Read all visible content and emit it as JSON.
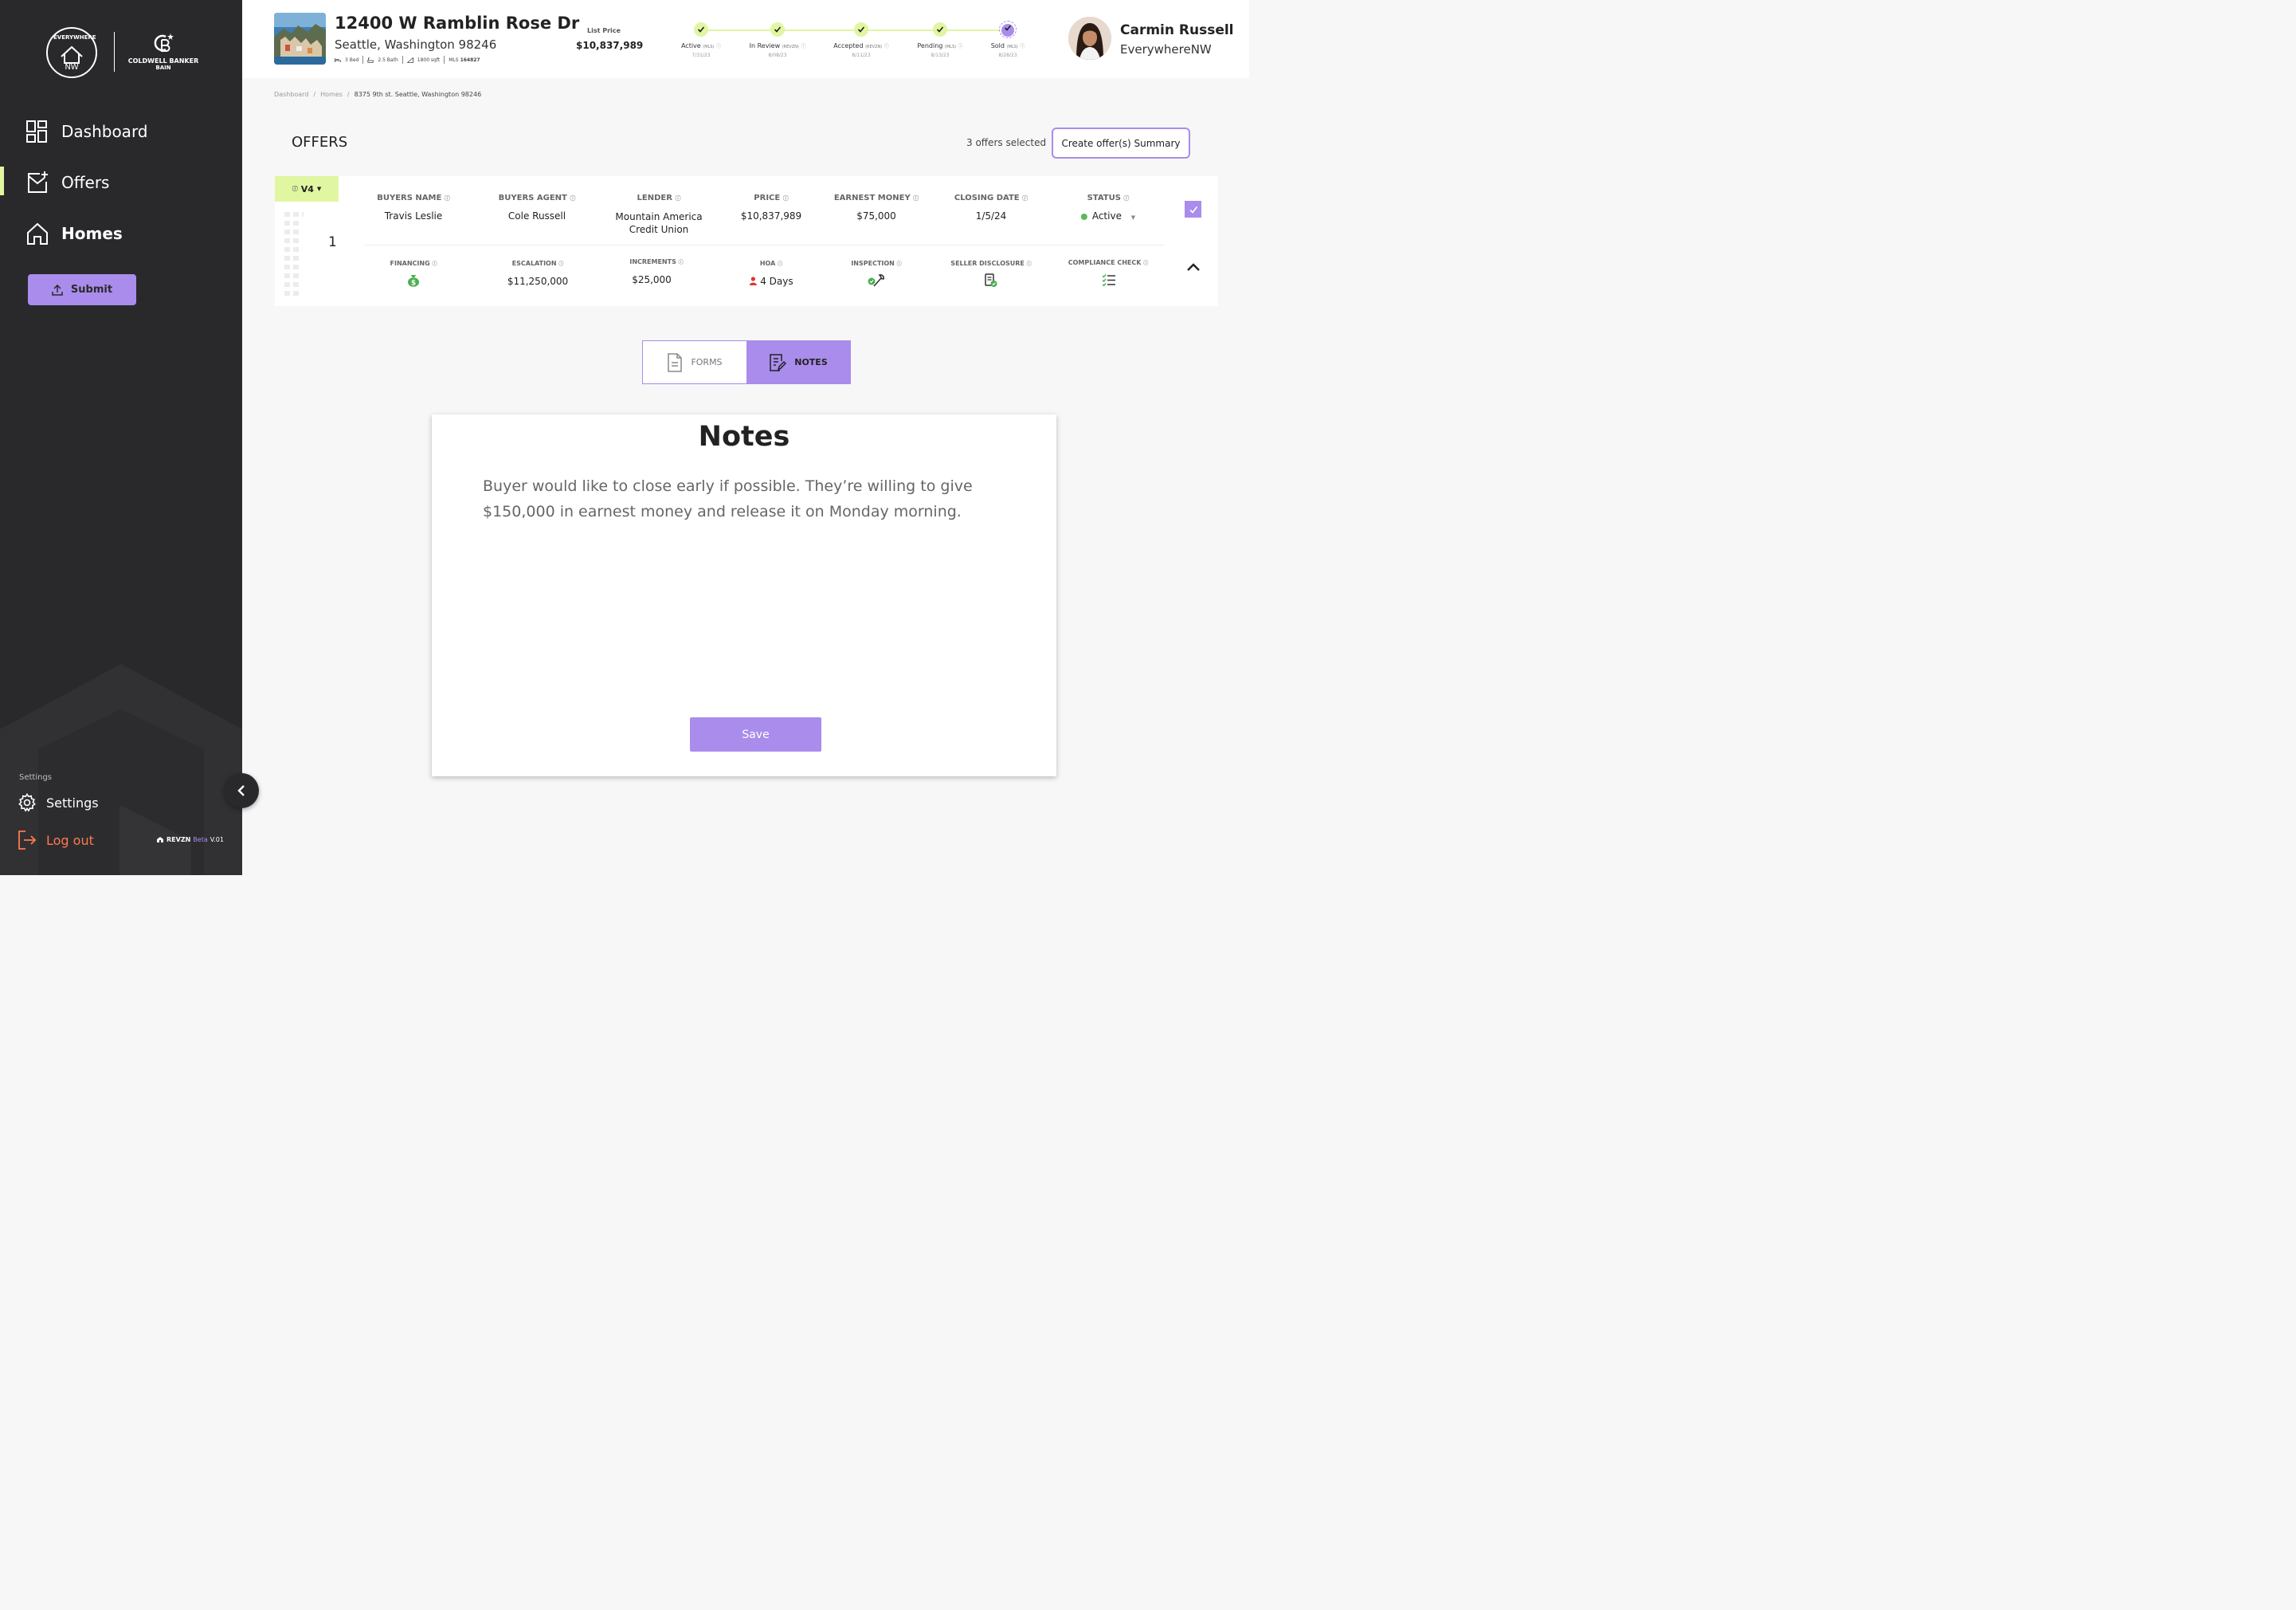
{
  "sidebar": {
    "logo_text": "EVERYWHERE",
    "logo_sub": "NW",
    "brand_name": "COLDWELL BANKER",
    "brand_sub": "BAIN",
    "nav": [
      {
        "label": "Dashboard",
        "icon": "dashboard-icon",
        "active": false
      },
      {
        "label": "Offers",
        "icon": "offers-icon",
        "active": true
      },
      {
        "label": "Homes",
        "icon": "home-icon",
        "active": false
      }
    ],
    "submit_label": "Submit",
    "settings_section_label": "Settings",
    "settings_label": "Settings",
    "logout_label": "Log out",
    "footer_brand": "REVZN",
    "footer_beta": "Beta",
    "footer_version": "V.01"
  },
  "header": {
    "address": "12400 W Ramblin Rose Dr",
    "city_line": "Seattle, Washington 98246",
    "beds": "3 Bed",
    "baths": "2.5 Bath",
    "sqft": "1800 sqft",
    "mls_label": "MLS",
    "mls_number": "164827",
    "list_price_label": "List Price",
    "list_price": "$10,837,989",
    "steps": [
      {
        "name": "Active",
        "tag": "(MLS)",
        "date": "7/31/23"
      },
      {
        "name": "In Review",
        "tag": "(REVZN)",
        "date": "8/08/23"
      },
      {
        "name": "Accepted",
        "tag": "(REVZN)",
        "date": "8/11/23"
      },
      {
        "name": "Pending",
        "tag": "(MLS)",
        "date": "8/13/23"
      },
      {
        "name": "Sold",
        "tag": "(MLS)",
        "date": "8/28/23"
      }
    ],
    "user_name": "Carmin Russell",
    "user_org": "EverywhereNW"
  },
  "breadcrumb": [
    "Dashboard",
    "Homes",
    "8375 9th st. Seattle, Washington 98246"
  ],
  "offers": {
    "title": "OFFERS",
    "selected_count": "3 offers selected",
    "summary_button": "Create offer(s) Summary"
  },
  "offer": {
    "version": "V4",
    "number": "1",
    "columns": [
      "BUYERS NAME",
      "BUYERS AGENT",
      "LENDER",
      "PRICE",
      "EARNEST MONEY",
      "CLOSING DATE",
      "STATUS"
    ],
    "buyers_name": "Travis Leslie",
    "buyers_agent": "Cole Russell",
    "lender_line1": "Mountain America",
    "lender_line2": "Credit Union",
    "price": "$10,837,989",
    "earnest_money": "$75,000",
    "closing_date": "1/5/24",
    "status": "Active",
    "details": [
      "FINANCING",
      "ESCALATION",
      "INCREMENTS",
      "HOA",
      "INSPECTION",
      "SELLER DISCLOSURE",
      "COMPLIANCE CHECK"
    ],
    "escalation": "$11,250,000",
    "increments": "$25,000",
    "hoa": "4 Days"
  },
  "tabs": {
    "forms": "FORMS",
    "notes": "NOTES"
  },
  "notes": {
    "title": "Notes",
    "text": "Buyer would like to close early if possible. They’re willing to give $150,000 in earnest money and release it on Monday morning.",
    "save_label": "Save"
  },
  "colors": {
    "sidebar": "#29292c",
    "accent": "#a98ceb",
    "highlight": "#e1f6a1",
    "logout": "#ff7a4d",
    "status_green": "#5cb85c"
  }
}
